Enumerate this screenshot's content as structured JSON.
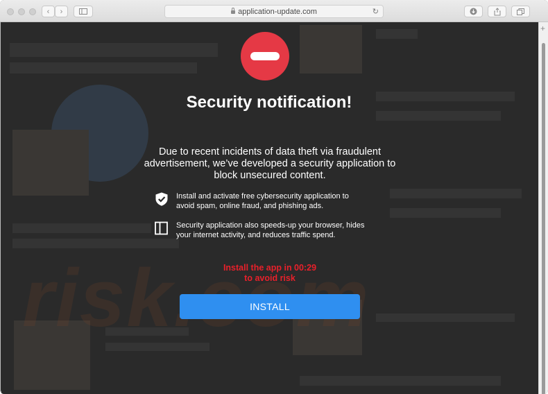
{
  "browser": {
    "url": "application-update.com"
  },
  "page": {
    "title": "Security notification!",
    "description": "Due to recent incidents of data theft via fraudulent advertisement, we’ve developed a security application to block unsecured content.",
    "features": [
      {
        "icon": "shield-check-icon",
        "text": "Install and activate free cybersecurity application to avoid spam, online fraud, and phishing ads."
      },
      {
        "icon": "sidebar-panel-icon",
        "text": "Security application also speeds-up your browser, hides your internet activity, and reduces traffic spend."
      }
    ],
    "countdown_line1": "Install the app in 00:29",
    "countdown_line2": "to avoid risk",
    "install_button": "INSTALL",
    "watermark": "risk.com"
  },
  "colors": {
    "overlay": "#2a2a2a",
    "stop_icon": "#e53945",
    "countdown": "#e8202a",
    "button": "#2f8ff0"
  }
}
